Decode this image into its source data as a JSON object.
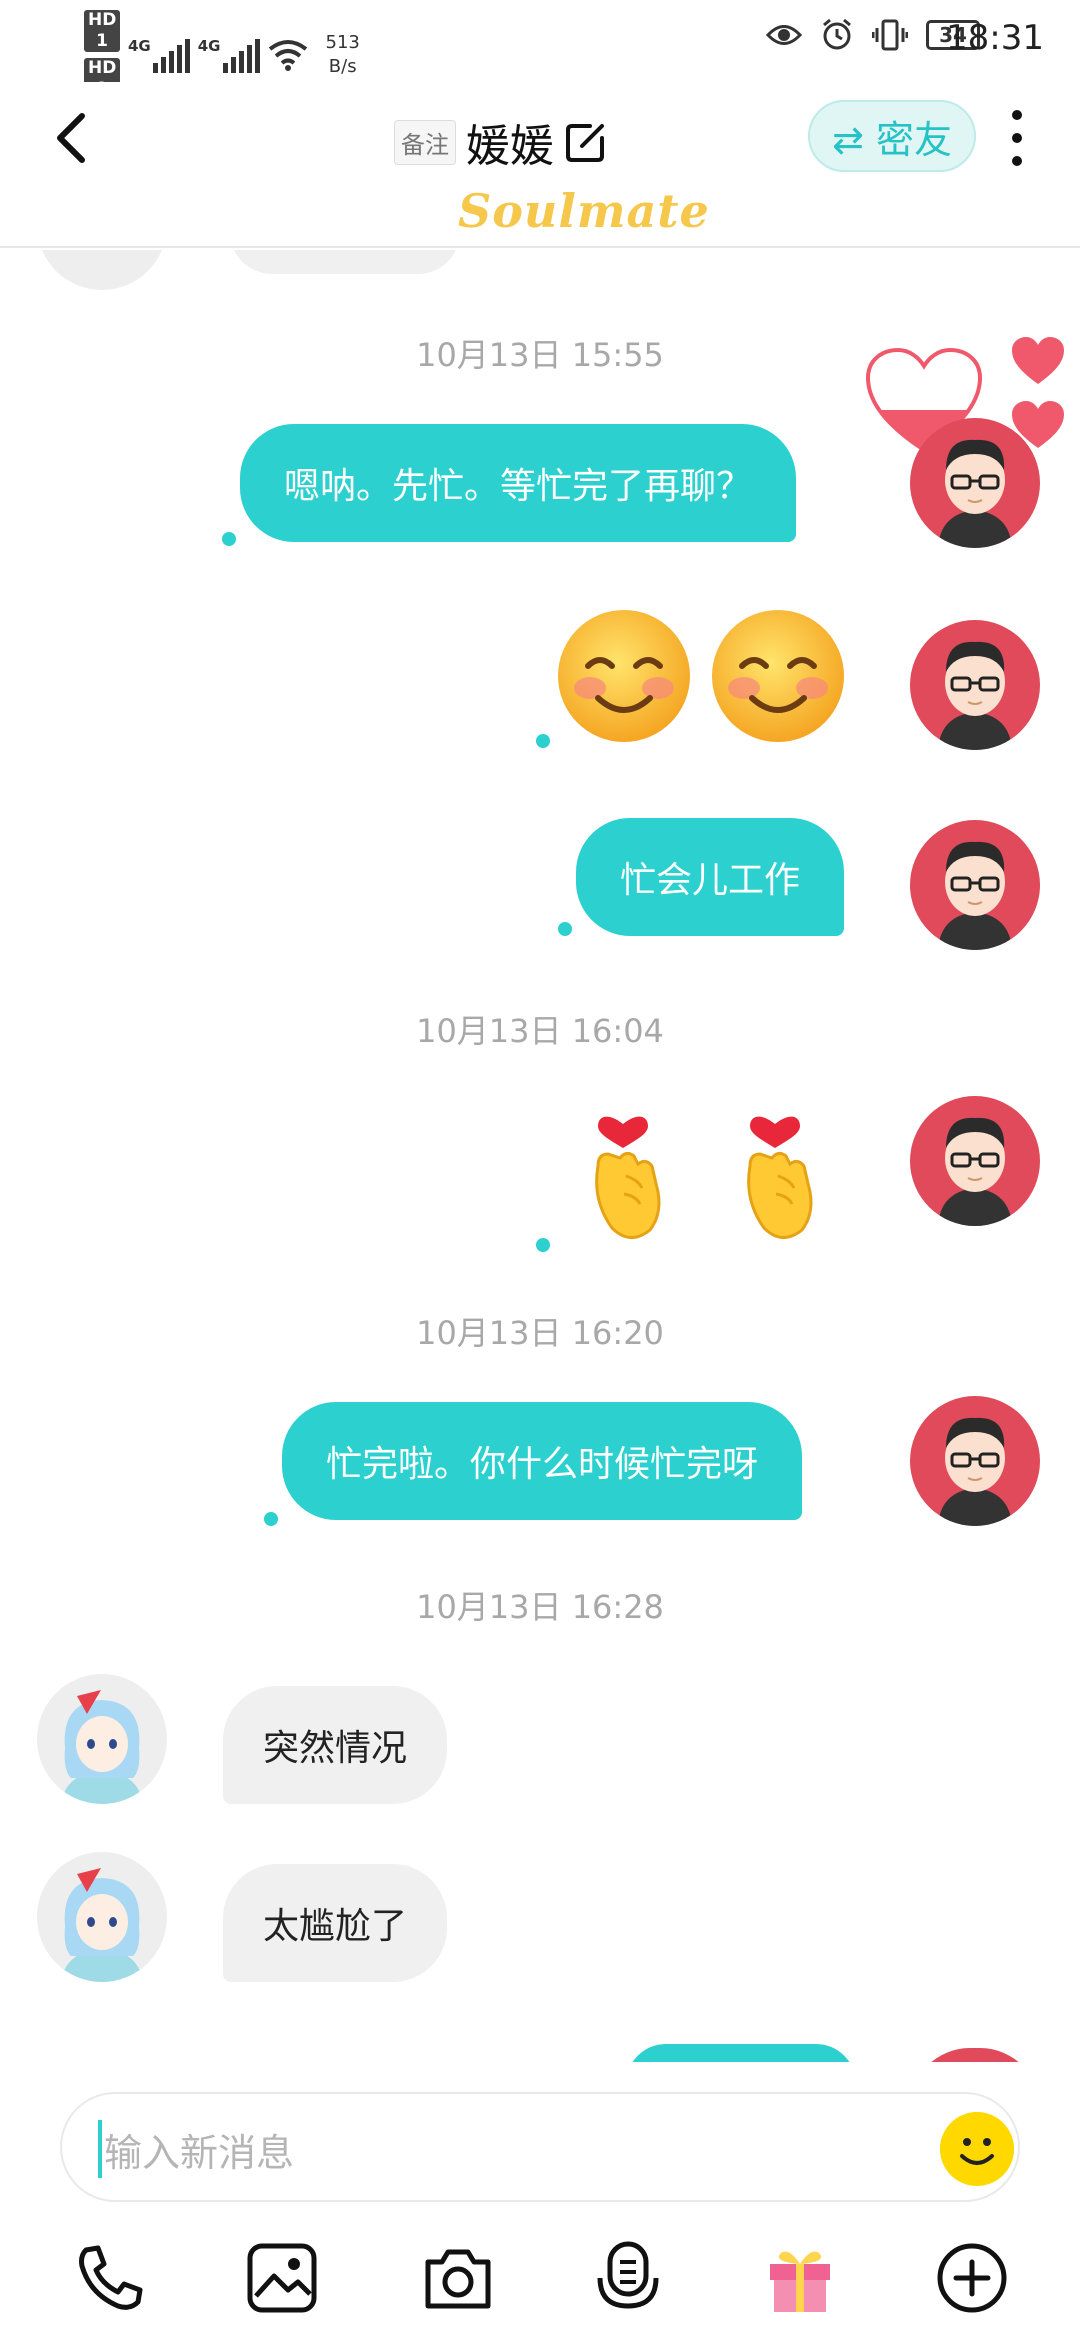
{
  "status_bar": {
    "hd1": "HD 1",
    "hd2": "HD 2",
    "net1": "4G",
    "net2": "4G",
    "speed_value": "513",
    "speed_unit": "B/s",
    "battery": "34",
    "time": "18:31"
  },
  "header": {
    "remark_label": "备注",
    "title": "媛媛",
    "friend_button": "⇄ 密友",
    "brand": "Soulmate"
  },
  "messages": {
    "t1": "10月13日 15:55",
    "m1": "嗯呐。先忙。等忙完了再聊？",
    "m3": "忙会儿工作",
    "t2": "10月13日 16:04",
    "t3": "10月13日 16:20",
    "m5": "忙完啦。你什么时候忙完呀",
    "t4": "10月13日 16:28",
    "m6": "突然情况",
    "m7": "太尴尬了"
  },
  "input": {
    "placeholder": "输入新消息"
  },
  "colors": {
    "accent": "#2cd0cf",
    "avatar_male_bg": "#e04a5a",
    "heart": "#f0596b"
  }
}
